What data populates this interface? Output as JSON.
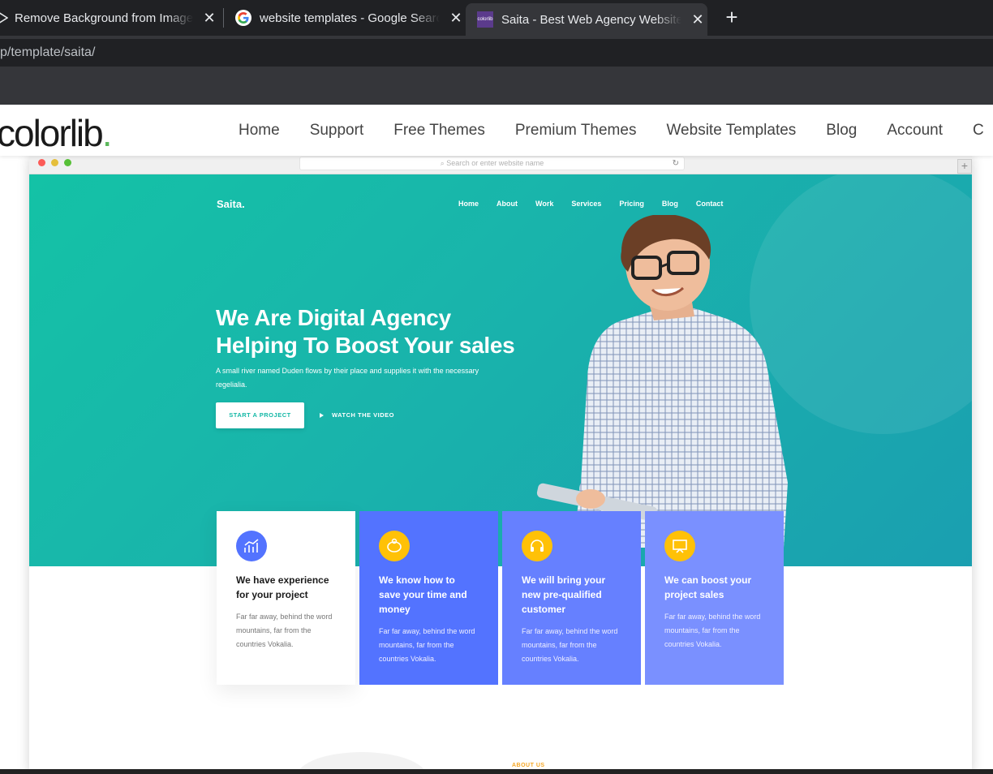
{
  "browser": {
    "tabs": [
      {
        "title": "Remove Background from Image",
        "close": "✕",
        "icon": "play-icon"
      },
      {
        "title": "website templates - Google Search",
        "close": "✕",
        "icon": "google-icon"
      },
      {
        "title": "Saita - Best Web Agency Website",
        "close": "✕",
        "icon": "colorlib-favicon",
        "favicon_text": "colorlib"
      }
    ],
    "new_tab": "+",
    "url": "p/template/saita/"
  },
  "colorlib": {
    "logo": "colorlib",
    "logo_dot": ".",
    "nav": [
      "Home",
      "Support",
      "Free Themes",
      "Premium Themes",
      "Website Templates",
      "Blog",
      "Account",
      "C"
    ]
  },
  "preview": {
    "search_placeholder": "Search or enter website name",
    "reload": "↻",
    "plus": "+"
  },
  "saita": {
    "logo": "Saita.",
    "nav": [
      "Home",
      "About",
      "Work",
      "Services",
      "Pricing",
      "Blog",
      "Contact"
    ],
    "hero": {
      "title_line1": "We Are Digital Agency",
      "title_line2": "Helping To Boost Your sales",
      "subtitle": "A small river named Duden flows by their place and supplies it with the necessary regelialia.",
      "cta_primary": "START A PROJECT",
      "cta_secondary": "WATCH THE VIDEO"
    },
    "cards": [
      {
        "title": "We have experience for your project",
        "text": "Far far away, behind the word mountains, far from the countries Vokalia.",
        "icon": "chart-icon"
      },
      {
        "title": "We know how to save your time and money",
        "text": "Far far away, behind the word mountains, far from the countries Vokalia.",
        "icon": "piggy-bank-icon"
      },
      {
        "title": "We will bring your new pre-qualified customer",
        "text": "Far far away, behind the word mountains, far from the countries Vokalia.",
        "icon": "headset-icon"
      },
      {
        "title": "We can boost your project sales",
        "text": "Far far away, behind the word mountains, far from the countries Vokalia.",
        "icon": "presentation-icon"
      }
    ],
    "about_label": "ABOUT US"
  },
  "colors": {
    "hero_teal": "#14c2a6",
    "card_blue": "#5373ff",
    "accent_yellow": "#ffc107",
    "colorlib_green": "#5cb85c"
  }
}
